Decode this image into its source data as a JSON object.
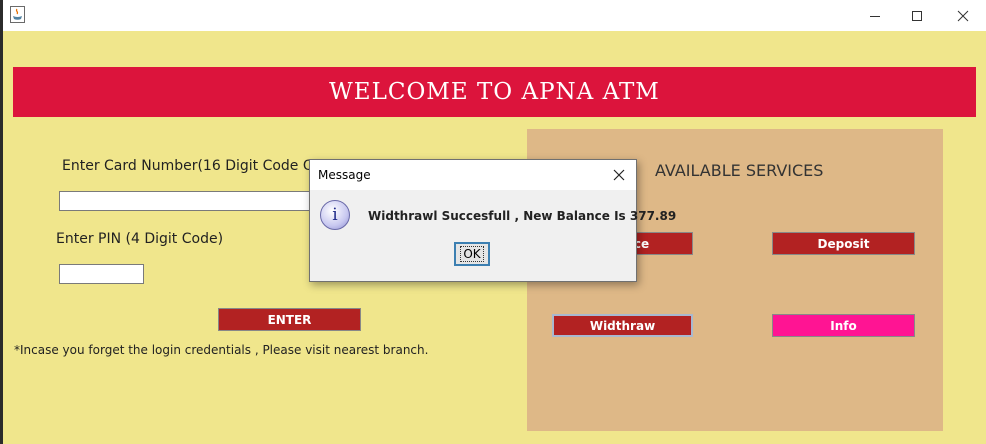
{
  "window": {
    "title": "",
    "minimize_glyph": "—",
    "maximize_glyph": "☐",
    "close_glyph": "✕"
  },
  "banner": {
    "text": "WELCOME TO APNA ATM"
  },
  "login": {
    "card_label": "Enter Card Number(16 Digit Code On",
    "card_value": "",
    "pin_label": "Enter PIN (4 Digit Code)",
    "pin_value": "",
    "enter_button": "ENTER",
    "note": "*Incase you forget the login credentials , Please visit nearest branch."
  },
  "services": {
    "title": "AVAILABLE SERVICES",
    "balance_button": "Balance",
    "deposit_button": "Deposit",
    "withdraw_button": "Widthraw",
    "info_button": "Info"
  },
  "dialog": {
    "title": "Message",
    "close_glyph": "✕",
    "icon_glyph": "i",
    "message": "Widthrawl Succesfull , New Balance Is 377.89",
    "ok_button": "OK"
  },
  "colors": {
    "background": "#f0e68c",
    "banner": "#dc143c",
    "services_panel": "#deb887",
    "button": "#b22222",
    "info_button": "#ff1493"
  }
}
